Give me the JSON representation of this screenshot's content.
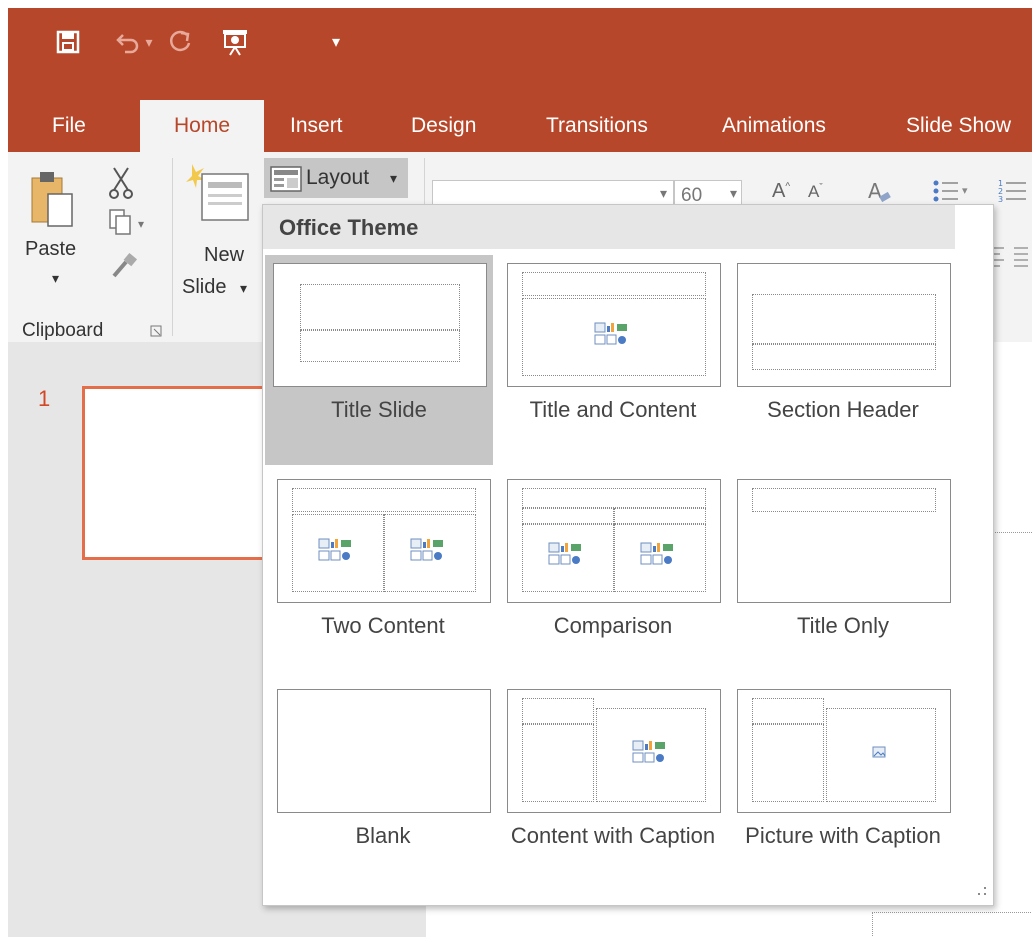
{
  "qat": {
    "icons": [
      "save-icon",
      "undo-icon",
      "redo-icon",
      "start-from-beginning-icon",
      "customize-qat-icon"
    ],
    "undo_arrow": "▾",
    "customize": "▾"
  },
  "tabs": [
    "File",
    "Home",
    "Insert",
    "Design",
    "Transitions",
    "Animations",
    "Slide Show"
  ],
  "ribbon": {
    "paste_label": "Paste",
    "paste_arrow": "▾",
    "clipboard_label": "Clipboard",
    "new_slide_label_1": "New",
    "new_slide_label_2": "Slide",
    "new_slide_arrow": "▾",
    "layout_label": "Layout",
    "layout_arrow": "▾",
    "font_size": "60",
    "dropdown_arrow": "▾"
  },
  "slides": {
    "number": "1"
  },
  "layout_dropdown": {
    "section_title": "Office Theme",
    "items": [
      {
        "label": "Title Slide",
        "selected": true
      },
      {
        "label": "Title and Content",
        "selected": false
      },
      {
        "label": "Section Header",
        "selected": false
      },
      {
        "label": "Two Content",
        "selected": false
      },
      {
        "label": "Comparison",
        "selected": false
      },
      {
        "label": "Title Only",
        "selected": false
      },
      {
        "label": "Blank",
        "selected": false
      },
      {
        "label": "Content with Caption",
        "selected": false
      },
      {
        "label": "Picture with Caption",
        "selected": false
      }
    ]
  },
  "colors": {
    "accent": "#b7472a",
    "thumbnail_border": "#e46e4a",
    "selected_item_bg": "#c6c6c6"
  }
}
